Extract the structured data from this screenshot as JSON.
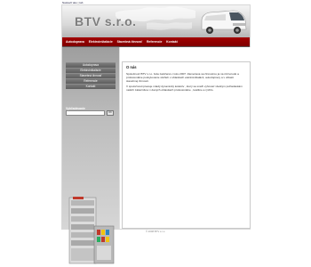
{
  "topbar": {
    "link1": "Nastaviť ako",
    "sep": " | ",
    "link2": "tab"
  },
  "header": {
    "logo_text": "BTV s.r.o."
  },
  "nav": {
    "items": [
      "Autodoprava",
      "Elektroinštalácie",
      "Stavebná činnosť",
      "Referencie",
      "Kontakt"
    ]
  },
  "sidebar": {
    "menu": [
      "Autodoprava",
      "Elektroinštalácie",
      "Stavebná činnosť",
      "Referencie",
      "Kontakt"
    ],
    "search_title": "Vyhľadávanie",
    "search_button": "OK"
  },
  "content": {
    "title": "O nás",
    "paragraphs": [
      "Spoločnosť BTV s.r.o. bola založená v roku 2007. Zameriava sa činnosťou ja na rôznorodé a profesionálne poskytovanie služieb v oblastiach elektroinštalácií, autodopravy a v oblasti stavebnej činnosti.",
      "V spoločnosti pracuje mladý dynamický kolektív , ktorý sa snaží vyhovieť všetkým požiadavkám našich zákazníkov v daných oblastiach profesionálne , kvalitne a rýchlo."
    ]
  },
  "footer": {
    "text": "© 2008 BTV s.r.o."
  },
  "colors": {
    "nav_bg": "#8f0000",
    "sidebar_menu_bg": "#6a6a6a",
    "site_bg": "#ececec"
  }
}
